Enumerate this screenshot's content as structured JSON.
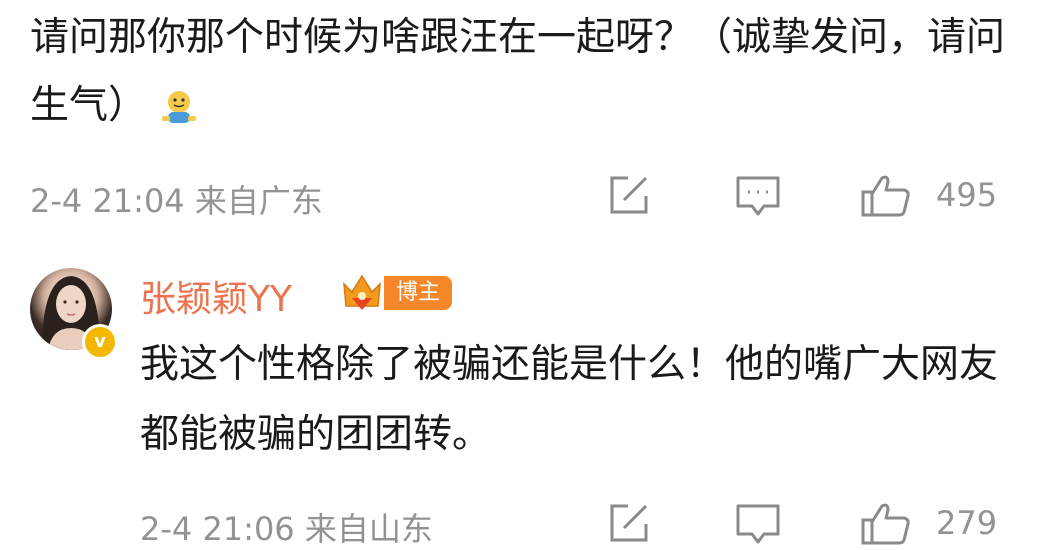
{
  "comment": {
    "text": "请问那你那个时候为啥跟汪在一起呀？（诚挚发问，请问生气）",
    "emoji": "doge-emoji",
    "timestamp": "2-4 21:04",
    "location": "来自广东",
    "like_count": "495"
  },
  "reply": {
    "username": "张颖颖YY",
    "author_tag": "博主",
    "text": "我这个性格除了被骗还能是什么！他的嘴广大网友都能被骗的团团转。",
    "timestamp": "2-4 21:06",
    "location": "来自山东",
    "like_count": "279"
  },
  "colors": {
    "username": "#eb7350",
    "meta": "#939393",
    "body_text": "#1a1a1a",
    "author_tag_bg": "#f5862a",
    "verify_badge": "#f5b800"
  },
  "icons": [
    "share-icon",
    "comment-icon",
    "like-icon",
    "crown-icon",
    "verified-icon"
  ]
}
